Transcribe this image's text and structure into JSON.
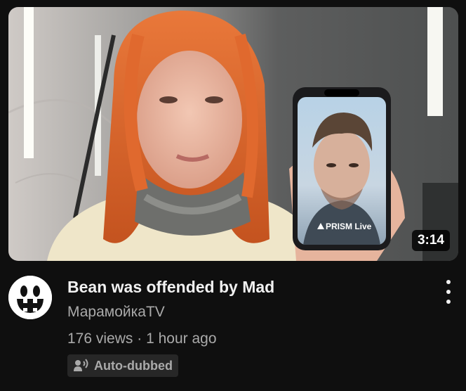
{
  "video": {
    "title": "Bean was offended by Mad",
    "channel": "МарамойкаTV",
    "views": "176 views",
    "separator": "·",
    "uploaded": "1 hour ago",
    "duration": "3:14",
    "badge": {
      "label": "Auto-dubbed",
      "icon": "speaker-dub-icon"
    },
    "thumbnail_text": "PRISM Live"
  },
  "colors": {
    "background": "#0f0f0f",
    "title": "#f1f1f1",
    "secondary_text": "#aaaaaa",
    "badge_bg": "#272727",
    "hair": "#d9652b"
  }
}
